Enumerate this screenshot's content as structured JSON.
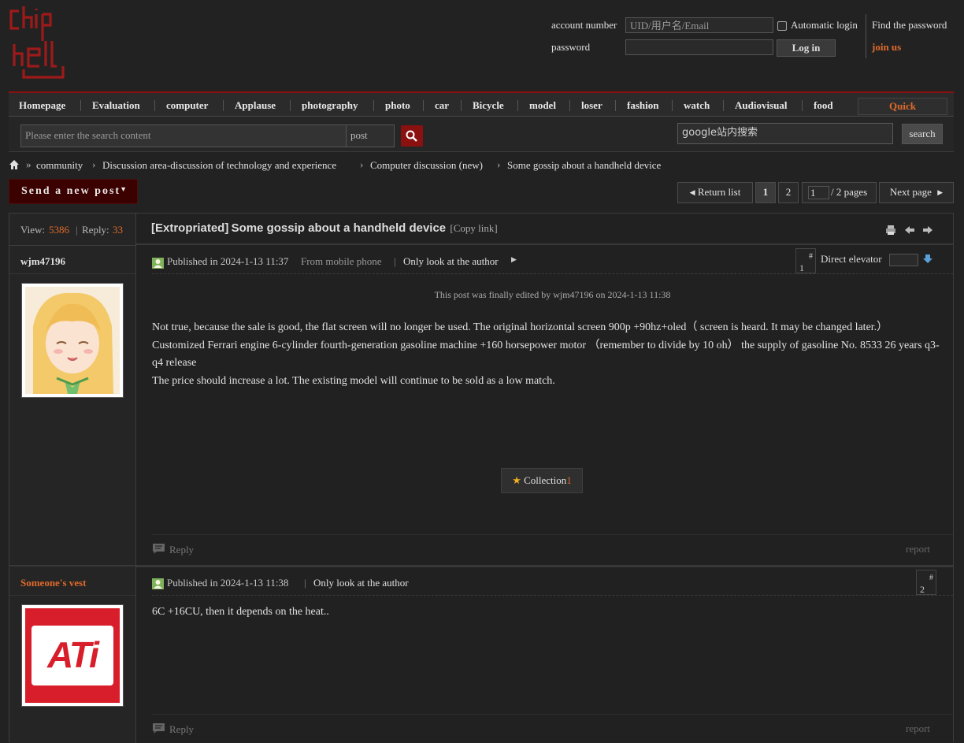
{
  "header": {
    "logo_text": "chiphell",
    "account_label": "account number",
    "account_placeholder": "UID/用户名/Email",
    "password_label": "password",
    "auto_login": "Automatic login",
    "login_button": "Log in",
    "find_password": "Find the password",
    "join_us": "join us"
  },
  "nav": {
    "items": [
      "Homepage",
      "Evaluation",
      "computer",
      "Applause",
      "photography",
      "photo",
      "car",
      "Bicycle",
      "model",
      "loser",
      "fashion",
      "watch",
      "Audiovisual",
      "food"
    ],
    "quick": "Quick"
  },
  "search": {
    "placeholder": "Please enter the search content",
    "type": "post",
    "google_placeholder": "google站内搜索",
    "google_button": "search"
  },
  "breadcrumb": {
    "items": [
      "community",
      "Discussion area-discussion of technology and experience",
      "Computer discussion (new)",
      "Some gossip about a handheld device"
    ]
  },
  "toolbar": {
    "new_post": "Send a new post",
    "return_list": "Return list",
    "page1": "1",
    "page2": "2",
    "page_input": "1",
    "total_pages": "/ 2 pages",
    "next_page": "Next page"
  },
  "thread": {
    "view_label": "View:",
    "views": "5386",
    "reply_label": "Reply:",
    "replies": "33",
    "tag": "[Extropriated]",
    "title": "Some gossip about a handheld device",
    "copy_link": "[Copy link]"
  },
  "posts": [
    {
      "author": "wjm47196",
      "published": "Published in 2024-1-13 11:37",
      "from": "From mobile phone",
      "only_author": "Only look at the author",
      "floor_hash": "#",
      "floor_num": "1",
      "direct_elevator": "Direct elevator",
      "edited_note": "This post was finally edited by wjm47196 on 2024-1-13 11:38",
      "lines": [
        "Not true, because the sale is good, the flat screen will no longer be used. The original horizontal screen 900p +90hz+oled（ screen is heard. It may be changed later.）",
        "Customized Ferrari engine 6-cylinder fourth-generation gasoline machine +160 horsepower motor （remember to divide by 10 oh） the supply of gasoline No. 8533 26 years q3-q4 release",
        "The price should increase a lot. The existing model will continue to be sold as a low match."
      ],
      "collection_label": "Collection",
      "collection_count": "1",
      "reply": "Reply",
      "report": "report"
    },
    {
      "author": "Someone's vest",
      "published": "Published in 2024-1-13 11:38",
      "only_author": "Only look at the author",
      "floor_hash": "#",
      "floor_num": "2",
      "avatar_text": "ATi",
      "lines": [
        "6C +16CU, then it depends on the heat.."
      ],
      "reply": "Reply",
      "report": "report"
    }
  ],
  "colors": {
    "accent_red": "#8b1010",
    "link_orange": "#e06a2a",
    "ati_red": "#d81e2a"
  }
}
